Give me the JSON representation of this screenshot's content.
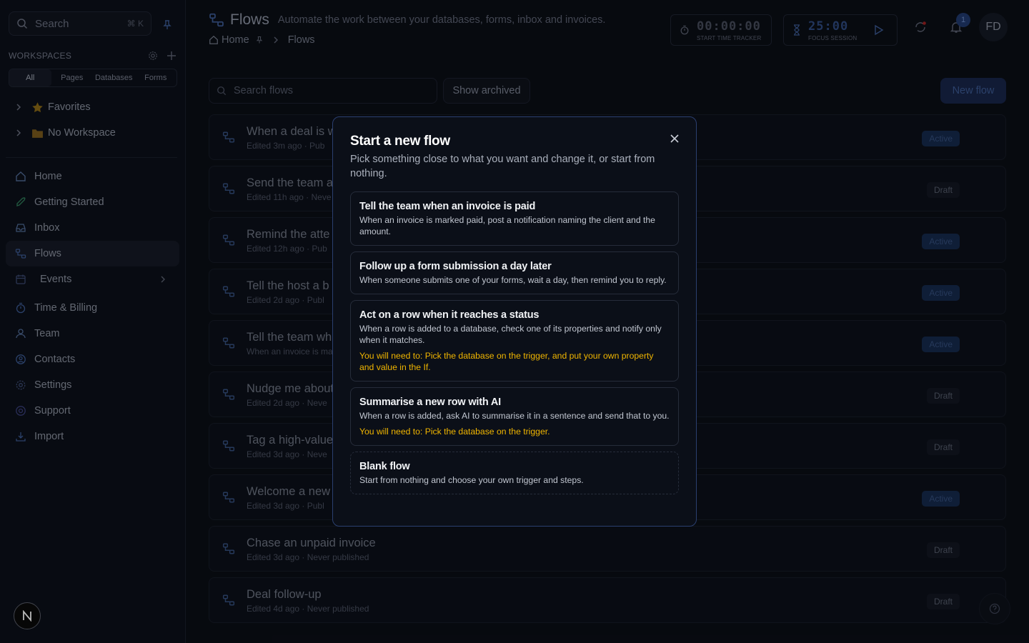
{
  "sidebar": {
    "search_placeholder": "Search",
    "search_shortcut": "⌘ K",
    "workspaces_label": "WORKSPACES",
    "filter_tabs": [
      "All",
      "Pages",
      "Databases",
      "Forms"
    ],
    "tree": [
      {
        "label": "Favorites",
        "icon": "star-icon"
      },
      {
        "label": "No Workspace",
        "icon": "folder-icon"
      }
    ],
    "nav": [
      {
        "label": "Home",
        "icon": "home-icon"
      },
      {
        "label": "Getting Started",
        "icon": "rocket-icon"
      },
      {
        "label": "Inbox",
        "icon": "inbox-icon"
      },
      {
        "label": "Flows",
        "icon": "flows-icon",
        "active": true
      },
      {
        "label": "Events",
        "icon": "calendar-icon",
        "has_arrow": true
      },
      {
        "label": "Time & Billing",
        "icon": "timer-icon"
      },
      {
        "label": "Team",
        "icon": "users-icon"
      },
      {
        "label": "Contacts",
        "icon": "contact-icon"
      },
      {
        "label": "Settings",
        "icon": "gear-icon"
      },
      {
        "label": "Support",
        "icon": "support-icon"
      },
      {
        "label": "Import",
        "icon": "import-icon"
      }
    ]
  },
  "header": {
    "title": "Flows",
    "subtitle": "Automate the work between your databases, forms, inbox and invoices.",
    "breadcrumb": [
      "Home",
      "Flows"
    ],
    "time_tracker": {
      "value": "00:00:00",
      "caption": "START TIME TRACKER"
    },
    "focus_session": {
      "value": "25:00",
      "caption": "FOCUS SESSION"
    },
    "notification_count": "1",
    "avatar_initials": "FD"
  },
  "toolbar": {
    "search_placeholder": "Search flows",
    "show_archived": "Show archived",
    "new_flow": "New flow"
  },
  "flows": [
    {
      "name": "When a deal is w",
      "meta": "Edited 3m ago · Pub",
      "status": "Active"
    },
    {
      "name": "Send the team a",
      "meta": "Edited 11h ago · Neve",
      "status": "Draft"
    },
    {
      "name": "Remind the atte",
      "meta": "Edited 12h ago · Pub",
      "status": "Active"
    },
    {
      "name": "Tell the host a b",
      "meta": "Edited 2d ago · Publ",
      "status": "Active"
    },
    {
      "name": "Tell the team wh",
      "meta": "When an invoice is ma",
      "status": "Active"
    },
    {
      "name": "Nudge me about",
      "meta": "Edited 2d ago · Neve",
      "status": "Draft"
    },
    {
      "name": "Tag a high-value",
      "meta": "Edited 3d ago · Neve",
      "status": "Draft"
    },
    {
      "name": "Welcome a new",
      "meta": "Edited 3d ago · Publ",
      "status": "Active"
    },
    {
      "name": "Chase an unpaid invoice",
      "meta": "Edited 3d ago · Never published",
      "status": "Draft"
    },
    {
      "name": "Deal follow-up",
      "meta": "Edited 4d ago · Never published",
      "status": "Draft"
    }
  ],
  "modal": {
    "title": "Start a new flow",
    "description": "Pick something close to what you want and change it, or start from nothing.",
    "templates": [
      {
        "title": "Tell the team when an invoice is paid",
        "desc": "When an invoice is marked paid, post a notification naming the client and the amount.",
        "note": ""
      },
      {
        "title": "Follow up a form submission a day later",
        "desc": "When someone submits one of your forms, wait a day, then remind you to reply.",
        "note": ""
      },
      {
        "title": "Act on a row when it reaches a status",
        "desc": "When a row is added to a database, check one of its properties and notify only when it matches.",
        "note": "You will need to: Pick the database on the trigger, and put your own property and value in the If."
      },
      {
        "title": "Summarise a new row with AI",
        "desc": "When a row is added, ask AI to summarise it in a sentence and send that to you.",
        "note": "You will need to: Pick the database on the trigger."
      },
      {
        "title": "Blank flow",
        "desc": "Start from nothing and choose your own trigger and steps.",
        "note": "",
        "blank": true
      }
    ]
  },
  "colors": {
    "background": "#0b0e16",
    "modal_border": "#2b3f70",
    "warning_text": "#f0b500",
    "active_badge": "#162a4d"
  }
}
